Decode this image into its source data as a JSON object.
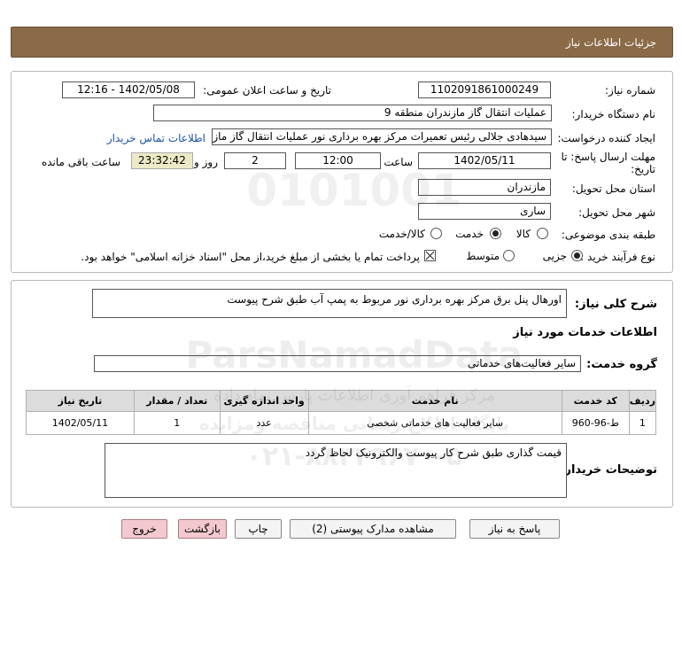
{
  "header": {
    "title": "جزئیات اطلاعات نیاز"
  },
  "form": {
    "need_number_label": "شماره نیاز:",
    "need_number": "1102091861000249",
    "announce_label": "تاریخ و ساعت اعلان عمومی:",
    "announce_value": "1402/05/08 - 12:16",
    "buyer_org_label": "نام دستگاه خریدار:",
    "buyer_org": "عملیات انتقال گاز مازندران منطقه 9",
    "creator_label": "ایجاد کننده درخواست:",
    "creator": "سیدهادی جلالی رئیس تعمیرات مرکز بهره برداری نور عملیات انتقال گاز مازندران",
    "contact_link": "اطلاعات تماس خریدار",
    "deadline_label_1": "مهلت ارسال پاسخ: تا",
    "deadline_label_2": "تاریخ:",
    "deadline_date": "1402/05/11",
    "time_label": "ساعت",
    "deadline_time": "12:00",
    "days_value": "2",
    "days_label": "روز و",
    "remaining_time": "23:32:42",
    "remaining_label": "ساعت باقی مانده",
    "province_label": "استان محل تحویل:",
    "province": "مازندران",
    "city_label": "شهر محل تحویل:",
    "city": "ساری",
    "category_label": "طبقه بندی موضوعی:",
    "category_options": [
      "کالا",
      "خدمت",
      "کالا/خدمت"
    ],
    "category_selected": "خدمت",
    "process_label": "نوع فرآیند خرید :",
    "process_options": [
      "جزیی",
      "متوسط"
    ],
    "process_selected": "جزیی",
    "payment_note": "پرداخت تمام یا بخشی از مبلغ خرید،از محل \"اسناد خزانه اسلامی\" خواهد بود."
  },
  "details": {
    "summary_label": "شرح کلی نیاز:",
    "summary": "اورهال پنل برق مرکز بهره برداری نور مربوط به پمپ آب طبق شرح پیوست",
    "services_title": "اطلاعات خدمات مورد نیاز",
    "service_group_label": "گروه خدمت:",
    "service_group": "سایر فعالیت‌های خدماتی",
    "table": {
      "headers": [
        "ردیف",
        "کد خدمت",
        "نام خدمت",
        "واحد اندازه گیری",
        "تعداد / مقدار",
        "تاریخ نیاز"
      ],
      "rows": [
        [
          "1",
          "ط-96-960",
          "سایر فعالیت های خدماتی شخصی",
          "عدد",
          "1",
          "1402/05/11"
        ]
      ]
    },
    "buyer_notes_label": "توضیحات خریدار:",
    "buyer_notes": "قیمت گذاری طبق شرح کار پیوست والکترونیک لحاظ گردد"
  },
  "buttons": {
    "reply": "پاسخ به نیاز",
    "attachments": "مشاهده مدارک پیوستی (2)",
    "print": "چاپ",
    "back": "بازگشت",
    "exit": "خروج"
  },
  "watermark": {
    "digits": "0101001",
    "brand": "ParsNamadData",
    "line1": "مرکز فراهم آوری اطلاعات پارس نماد داده",
    "line2": "پایگاه اطلاع رسانی مناقصه ومزایده",
    "phone": "۰۲۱-۸۸۳۴۹۶۷۰-۵"
  }
}
